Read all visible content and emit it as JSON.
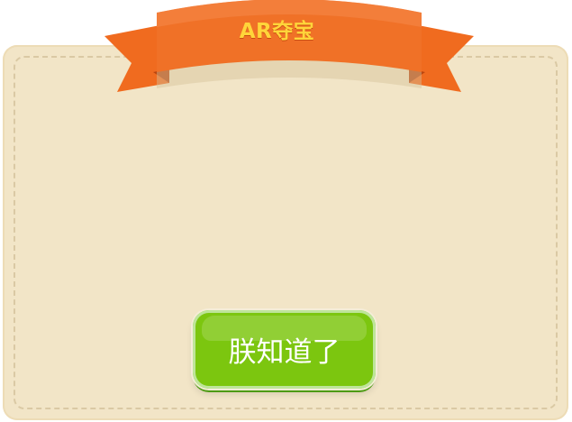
{
  "dialog": {
    "title": "AR夺宝",
    "ok_label": "朕知道了"
  },
  "colors": {
    "panel": "#f2e5c7",
    "ribbon": "#f07127",
    "title_text": "#ffd53a",
    "button": "#7cc60f"
  },
  "icons": {
    "banner": "ribbon-banner-icon"
  }
}
